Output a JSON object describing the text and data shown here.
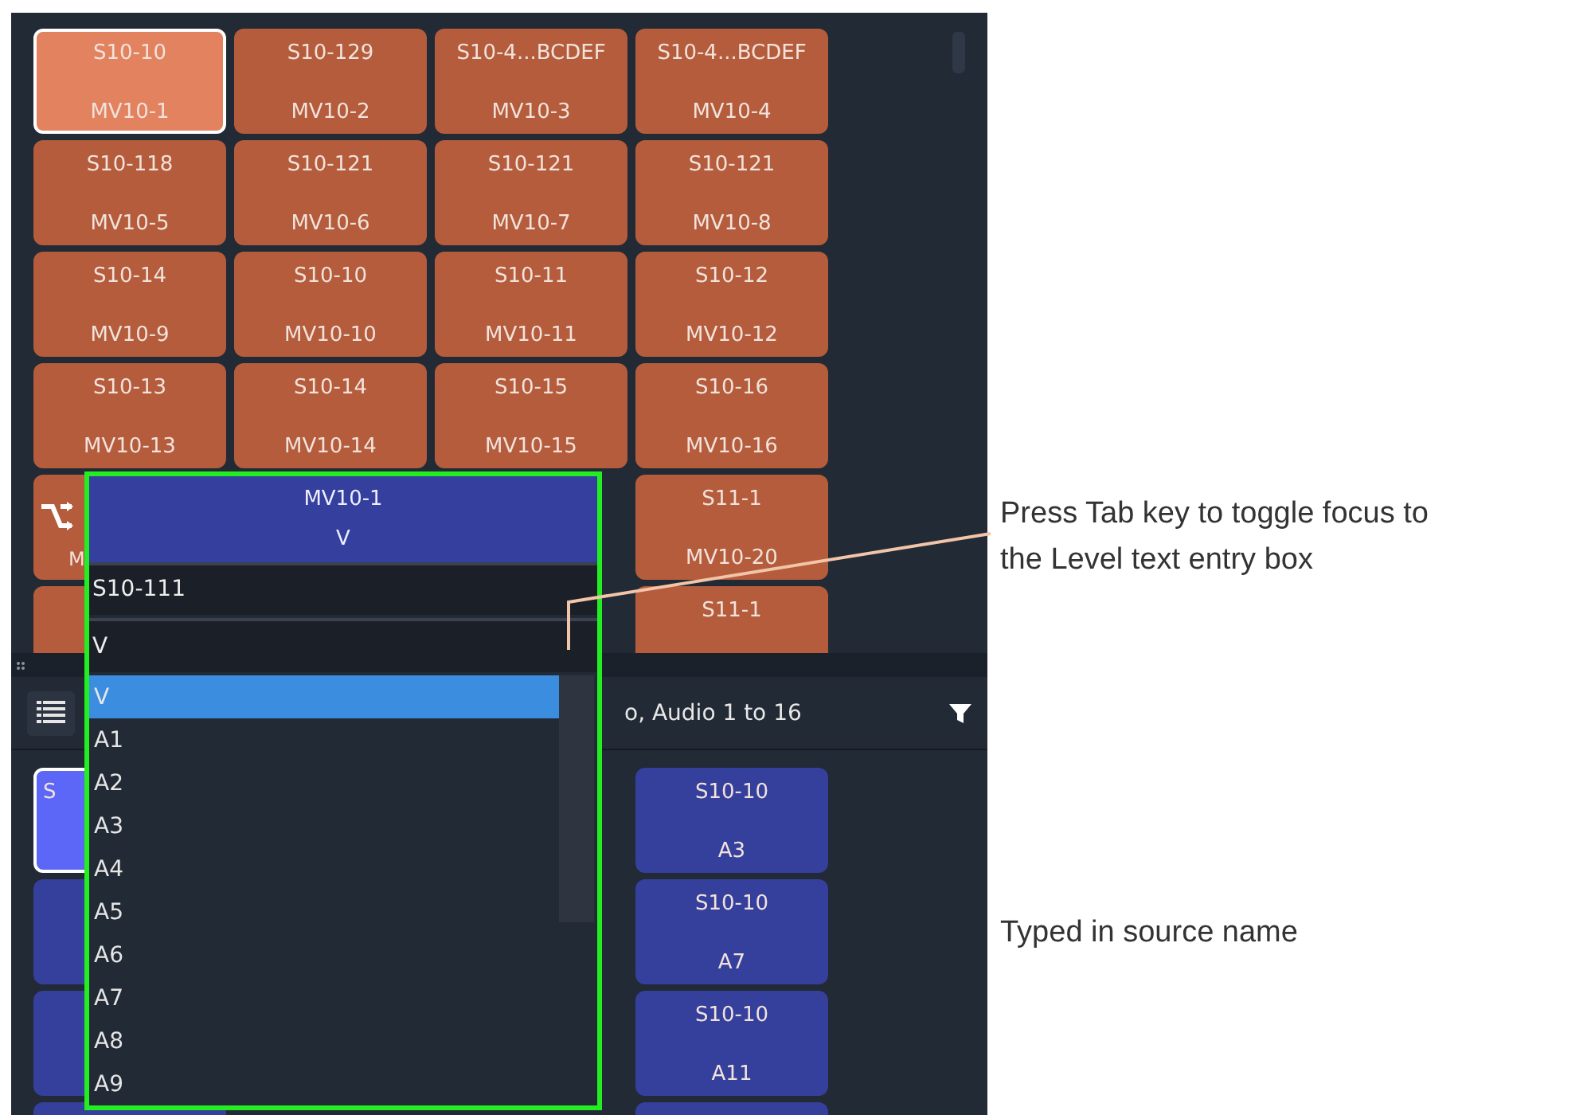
{
  "top_grid": {
    "tiles": [
      {
        "kind": "tile",
        "source": "S10-10",
        "destination": "MV10-1",
        "selected": true
      },
      {
        "kind": "tile",
        "source": "S10-129",
        "destination": "MV10-2",
        "selected": false
      },
      {
        "kind": "tile",
        "source": "S10-4...BCDEF",
        "destination": "MV10-3",
        "selected": false
      },
      {
        "kind": "tile",
        "source": "S10-4...BCDEF",
        "destination": "MV10-4",
        "selected": false
      },
      {
        "kind": "tile",
        "source": "S10-118",
        "destination": "MV10-5",
        "selected": false
      },
      {
        "kind": "tile",
        "source": "S10-121",
        "destination": "MV10-6",
        "selected": false
      },
      {
        "kind": "tile",
        "source": "S10-121",
        "destination": "MV10-7",
        "selected": false
      },
      {
        "kind": "tile",
        "source": "S10-121",
        "destination": "MV10-8",
        "selected": false
      },
      {
        "kind": "tile",
        "source": "S10-14",
        "destination": "MV10-9",
        "selected": false
      },
      {
        "kind": "tile",
        "source": "S10-10",
        "destination": "MV10-10",
        "selected": false
      },
      {
        "kind": "tile",
        "source": "S10-11",
        "destination": "MV10-11",
        "selected": false
      },
      {
        "kind": "tile",
        "source": "S10-12",
        "destination": "MV10-12",
        "selected": false
      },
      {
        "kind": "tile",
        "source": "S10-13",
        "destination": "MV10-13",
        "selected": false
      },
      {
        "kind": "tile",
        "source": "S10-14",
        "destination": "MV10-14",
        "selected": false
      },
      {
        "kind": "tile",
        "source": "S10-15",
        "destination": "MV10-15",
        "selected": false
      },
      {
        "kind": "tile",
        "source": "S10-16",
        "destination": "MV10-16",
        "selected": false
      },
      {
        "kind": "route",
        "destination": "M",
        "selected": false
      },
      {
        "kind": "covered"
      },
      {
        "kind": "covered"
      },
      {
        "kind": "tile",
        "source": "S11-1",
        "destination": "MV10-20",
        "selected": false
      },
      {
        "kind": "blank",
        "selected": false
      },
      {
        "kind": "covered"
      },
      {
        "kind": "covered"
      },
      {
        "kind": "tile",
        "source": "S11-1",
        "selected": false
      }
    ]
  },
  "toolbar": {
    "title": "o, Audio 1 to 16"
  },
  "bottom_grid": {
    "tiles": [
      {
        "kind": "cut",
        "source": "S",
        "selected": true
      },
      {
        "kind": "covered"
      },
      {
        "kind": "covered"
      },
      {
        "kind": "tile",
        "source": "S10-10",
        "destination": "A3",
        "selected": false
      },
      {
        "kind": "blank",
        "selected": false
      },
      {
        "kind": "covered"
      },
      {
        "kind": "covered"
      },
      {
        "kind": "tile",
        "source": "S10-10",
        "destination": "A7",
        "selected": false
      },
      {
        "kind": "blank",
        "selected": false
      },
      {
        "kind": "covered"
      },
      {
        "kind": "covered"
      },
      {
        "kind": "tile",
        "source": "S10-10",
        "destination": "A11",
        "selected": false
      },
      {
        "kind": "blank",
        "selected": false
      },
      {
        "kind": "covered"
      },
      {
        "kind": "covered"
      },
      {
        "kind": "blank",
        "selected": false
      }
    ]
  },
  "popup": {
    "destination": "MV10-1",
    "level": "V",
    "source_value": "S10-111",
    "level_value": "V",
    "levels": [
      {
        "label": "V",
        "selected": true
      },
      {
        "label": "A1",
        "selected": false
      },
      {
        "label": "A2",
        "selected": false
      },
      {
        "label": "A3",
        "selected": false
      },
      {
        "label": "A4",
        "selected": false
      },
      {
        "label": "A5",
        "selected": false
      },
      {
        "label": "A6",
        "selected": false
      },
      {
        "label": "A7",
        "selected": false
      },
      {
        "label": "A8",
        "selected": false
      },
      {
        "label": "A9",
        "selected": false
      }
    ]
  },
  "callouts": [
    {
      "text": "Press Tab key to toggle focus to the Level text entry box"
    },
    {
      "text": "Typed in source name"
    }
  ]
}
